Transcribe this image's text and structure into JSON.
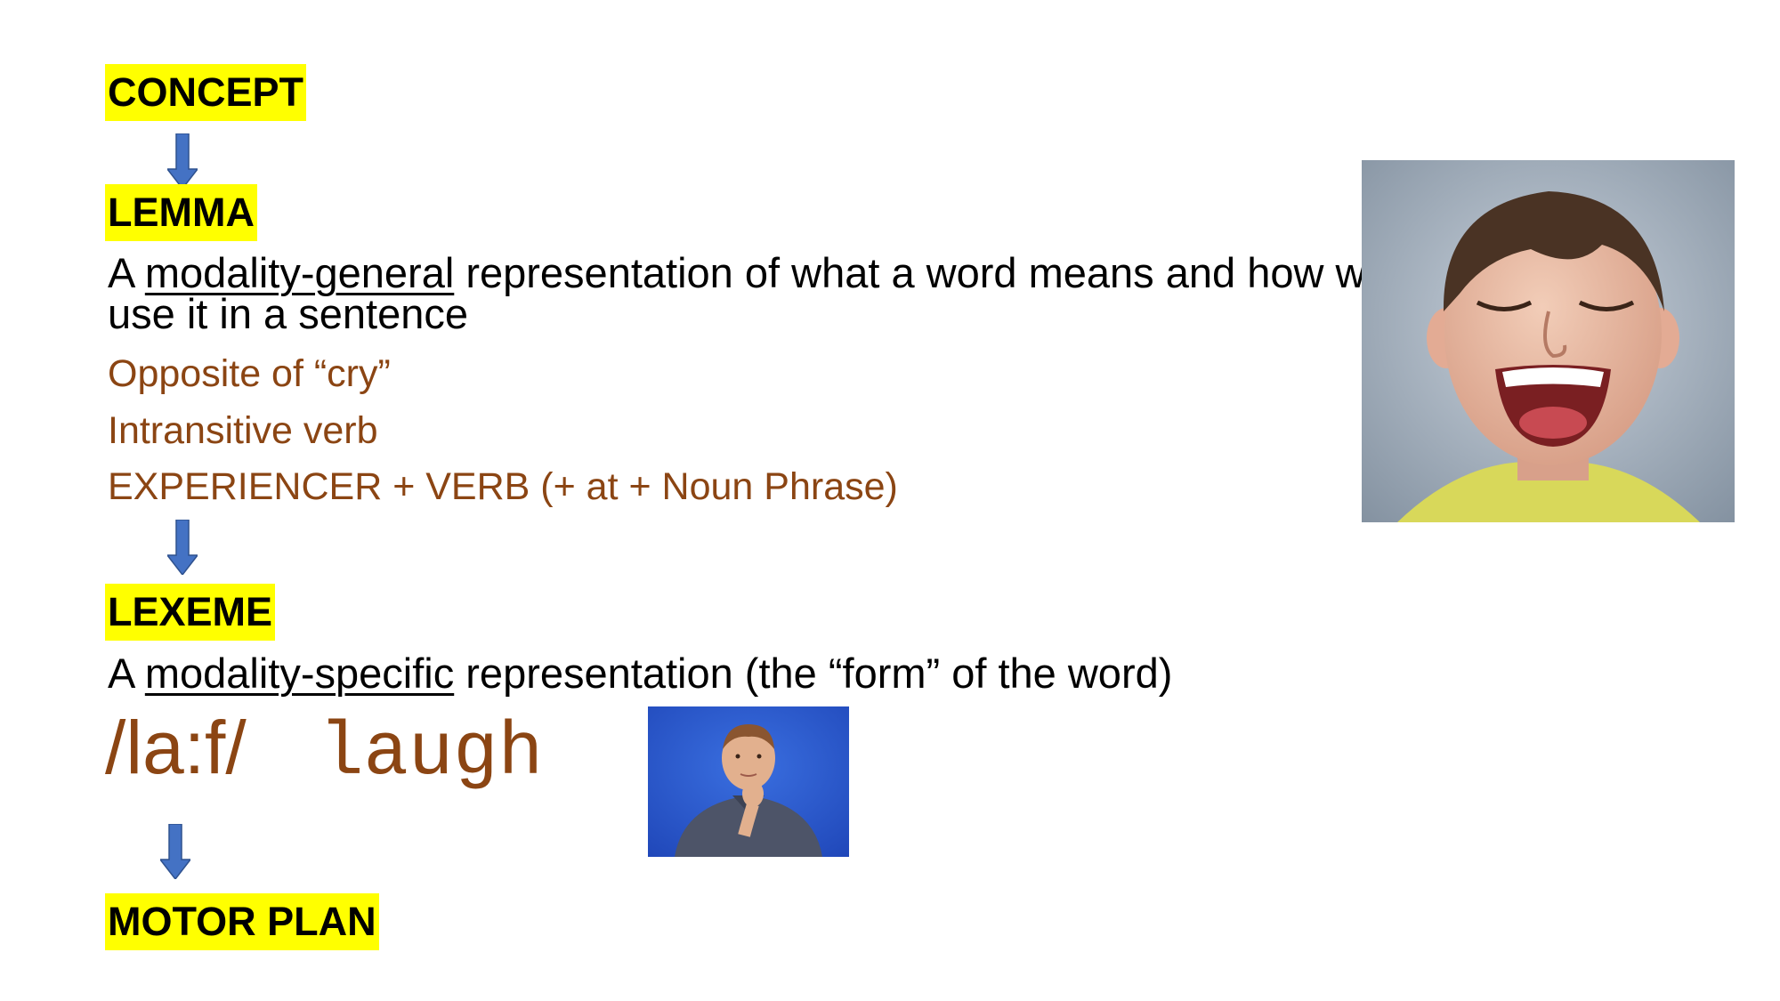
{
  "stages": {
    "concept": "CONCEPT",
    "lemma": "LEMMA",
    "lexeme": "LEXEME",
    "motor_plan": "MOTOR PLAN"
  },
  "lemma_desc": {
    "prefix": "A ",
    "underlined": "modality-general",
    "rest": " representation of what a word means and how we use it in a sentence"
  },
  "lemma_examples": [
    "Opposite of “cry”",
    "Intransitive verb",
    "EXPERIENCER + VERB (+ at + Noun Phrase)"
  ],
  "lexeme_desc": {
    "prefix": "A ",
    "underlined": "modality-specific",
    "rest": " representation (the “form” of the word)"
  },
  "lexeme_forms": {
    "phonological": "/la:f/",
    "orthographic": "laugh"
  },
  "colors": {
    "highlight": "#ffff00",
    "example_text": "#8b4513",
    "arrow": "#4472c4"
  },
  "icons": {
    "arrow": "down-arrow-icon"
  }
}
